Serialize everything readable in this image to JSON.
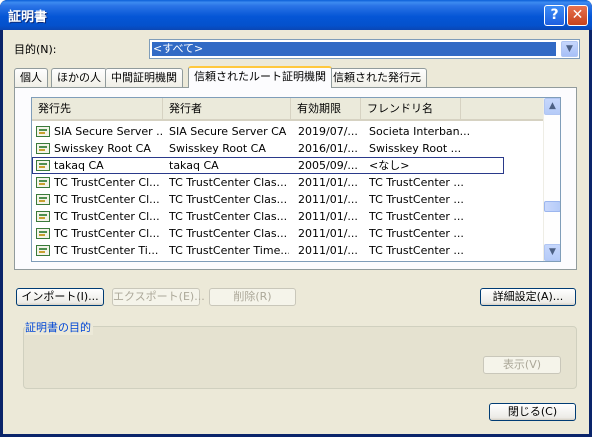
{
  "window": {
    "title": "証明書",
    "help_glyph": "?",
    "close_glyph": "✕"
  },
  "purpose": {
    "label": "目的(N):",
    "selected": "<すべて>"
  },
  "tabs": [
    {
      "label": "個人",
      "active": false
    },
    {
      "label": "ほかの人",
      "active": false
    },
    {
      "label": "中間証明機関",
      "active": false
    },
    {
      "label": "信頼されたルート証明機関",
      "active": true
    },
    {
      "label": "信頼された発行元",
      "active": false
    }
  ],
  "columns": [
    "発行先",
    "発行者",
    "有効期限",
    "フレンドリ名"
  ],
  "rows": [
    {
      "issued_to": "SIA Secure Server ...",
      "issued_by": "SIA Secure Server CA",
      "expires": "2019/07/...",
      "friendly": "Societa Interban..."
    },
    {
      "issued_to": "Swisskey Root CA",
      "issued_by": "Swisskey Root CA",
      "expires": "2016/01/...",
      "friendly": "Swisskey Root ..."
    },
    {
      "issued_to": "takaq CA",
      "issued_by": "takaq CA",
      "expires": "2005/09/...",
      "friendly": "<なし>"
    },
    {
      "issued_to": "TC TrustCenter Cl...",
      "issued_by": "TC TrustCenter Clas...",
      "expires": "2011/01/...",
      "friendly": "TC TrustCenter ..."
    },
    {
      "issued_to": "TC TrustCenter Cl...",
      "issued_by": "TC TrustCenter Clas...",
      "expires": "2011/01/...",
      "friendly": "TC TrustCenter ..."
    },
    {
      "issued_to": "TC TrustCenter Cl...",
      "issued_by": "TC TrustCenter Clas...",
      "expires": "2011/01/...",
      "friendly": "TC TrustCenter ..."
    },
    {
      "issued_to": "TC TrustCenter Cl...",
      "issued_by": "TC TrustCenter Clas...",
      "expires": "2011/01/...",
      "friendly": "TC TrustCenter ..."
    },
    {
      "issued_to": "TC TrustCenter Ti...",
      "issued_by": "TC TrustCenter Time...",
      "expires": "2011/01/...",
      "friendly": "TC TrustCenter ..."
    }
  ],
  "selected_row": 2,
  "buttons": {
    "import": "インポート(I)...",
    "export": "エクスポート(E)...",
    "remove": "削除(R)",
    "advanced": "詳細設定(A)...",
    "view": "表示(V)",
    "close": "閉じる(C)"
  },
  "group": {
    "label": "証明書の目的"
  },
  "colors": {
    "title_bar": "#0556d6",
    "dialog_bg": "#ece9d8",
    "selection": "#316ac5",
    "group_label": "#0046d5"
  }
}
